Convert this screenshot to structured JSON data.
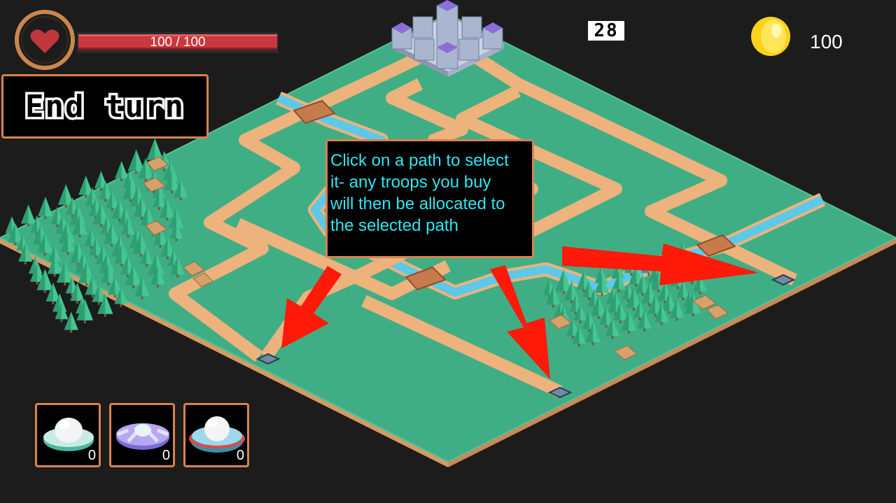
{
  "hud": {
    "health": {
      "current": 100,
      "max": 100,
      "label": "100 / 100",
      "fraction": 1.0
    },
    "end_turn_label": "End turn",
    "turn_counter": "28",
    "gold": "100"
  },
  "tooltip": {
    "lines": [
      "Click on a path to select",
      "it- any troops you buy",
      "will then be allocated to",
      "the selected path"
    ]
  },
  "troops": [
    {
      "name": "white-dome-ufo-icon",
      "count": "0"
    },
    {
      "name": "purple-saucer-ufo-icon",
      "count": "0"
    },
    {
      "name": "red-striped-ufo-icon",
      "count": "0"
    }
  ],
  "colors": {
    "grass": "#3fae85",
    "path": "#eeb27c",
    "river": "#5cc9e8",
    "trees": "#3cbf8a",
    "accent": "#d9834a",
    "arrow": "#ff1a0a",
    "tooltip_text": "#2fe6f0",
    "health": "#c9383d",
    "coin": "#ffd21a"
  }
}
